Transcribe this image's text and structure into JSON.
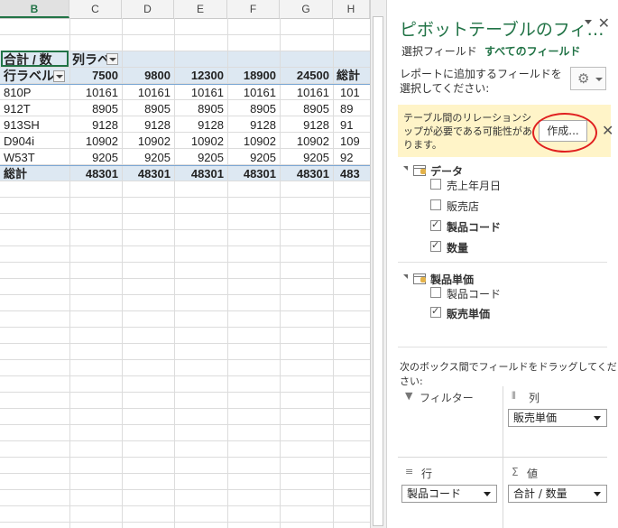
{
  "sheet": {
    "columns": [
      "B",
      "C",
      "D",
      "E",
      "F",
      "G",
      "H"
    ],
    "selected_column": "B",
    "pivot": {
      "corner_label": "合計 / 数",
      "col_label": "列ラベ",
      "row_label": "行ラベル",
      "col_headers": [
        "7500",
        "9800",
        "12300",
        "18900",
        "24500",
        "総計"
      ],
      "rows": [
        {
          "label": "810P",
          "values": [
            "10161",
            "10161",
            "10161",
            "10161",
            "10161",
            "101"
          ]
        },
        {
          "label": "912T",
          "values": [
            "8905",
            "8905",
            "8905",
            "8905",
            "8905",
            "89"
          ]
        },
        {
          "label": "913SH",
          "values": [
            "9128",
            "9128",
            "9128",
            "9128",
            "9128",
            "91"
          ]
        },
        {
          "label": "D904i",
          "values": [
            "10902",
            "10902",
            "10902",
            "10902",
            "10902",
            "109"
          ]
        },
        {
          "label": "W53T",
          "values": [
            "9205",
            "9205",
            "9205",
            "9205",
            "9205",
            "92"
          ]
        }
      ],
      "total": {
        "label": "総計",
        "values": [
          "48301",
          "48301",
          "48301",
          "48301",
          "48301",
          "483"
        ]
      }
    }
  },
  "panel": {
    "title": "ピボットテーブルのフィ…",
    "tabs": [
      "選択フィールド",
      "すべてのフィールド"
    ],
    "instruction": "レポートに追加するフィールドを選択してください:",
    "notice": "テーブル間のリレーションシップが必要である可能性があります。",
    "create_label": "作成...",
    "tables": [
      {
        "name": "データ",
        "fields": [
          {
            "label": "売上年月日",
            "checked": false
          },
          {
            "label": "販売店",
            "checked": false
          },
          {
            "label": "製品コード",
            "checked": true
          },
          {
            "label": "数量",
            "checked": true
          }
        ]
      },
      {
        "name": "製品単価",
        "fields": [
          {
            "label": "製品コード",
            "checked": false
          },
          {
            "label": "販売単価",
            "checked": true
          }
        ]
      }
    ],
    "drag_help": "次のボックス間でフィールドをドラッグしてください:",
    "areas": {
      "filter": {
        "title": "フィルター"
      },
      "columns": {
        "title": "列",
        "value": "販売単価"
      },
      "rows": {
        "title": "行",
        "value": "製品コード"
      },
      "values": {
        "title": "値",
        "value": "合計 / 数量"
      }
    }
  }
}
